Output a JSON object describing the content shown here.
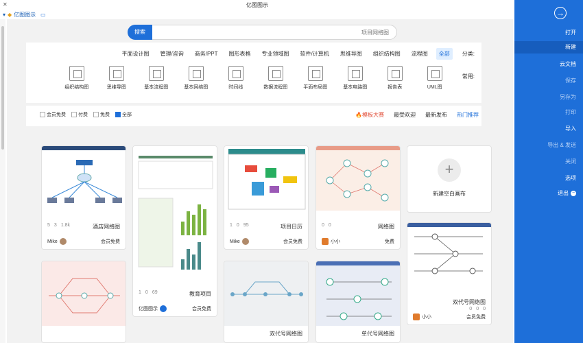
{
  "window": {
    "title": "亿图图示",
    "app_badge": "亿图图示"
  },
  "search": {
    "button": "搜索",
    "placeholder": "项目网络图"
  },
  "categories": {
    "label": "分类:",
    "items": [
      "全部",
      "流程图",
      "组织结构图",
      "思维导图",
      "软件/计算机",
      "专业领域图",
      "图形表格",
      "商务/PPT",
      "管理/咨询",
      "平面设计图"
    ],
    "active": 0
  },
  "common": {
    "label": "常用:",
    "items": [
      {
        "label": "UML图",
        "icon": "uml-icon"
      },
      {
        "label": "报告表",
        "icon": "report-icon"
      },
      {
        "label": "基本电路图",
        "icon": "circuit-icon"
      },
      {
        "label": "平面布局图",
        "icon": "floor-plan-icon"
      },
      {
        "label": "数据流程图",
        "icon": "dataflow-icon"
      },
      {
        "label": "时间线",
        "icon": "timeline-icon"
      },
      {
        "label": "基本网络图",
        "icon": "network-icon"
      },
      {
        "label": "基本流程图",
        "icon": "flowchart-icon"
      },
      {
        "label": "思维导图",
        "icon": "mindmap-icon"
      },
      {
        "label": "组织结构图",
        "icon": "org-icon"
      }
    ]
  },
  "filter": {
    "tabs": [
      {
        "label": "热门推荐",
        "active": true
      },
      {
        "label": "最新发布"
      },
      {
        "label": "最受欢迎"
      },
      {
        "label": "模板大赛",
        "fire": true
      }
    ],
    "checks": [
      {
        "label": "全部",
        "checked": true
      },
      {
        "label": "免费"
      },
      {
        "label": "付费"
      },
      {
        "label": "会员免费"
      }
    ]
  },
  "cards": {
    "new": {
      "label": "新建空白画布"
    },
    "c1": {
      "name": "网络图",
      "views": "0",
      "likes": "0",
      "author": "小小",
      "price": "免费"
    },
    "c2": {
      "name": "项目日历",
      "views": "95",
      "likes": "0",
      "saves": "1",
      "author": "Mike",
      "price": "会员免费"
    },
    "c3": {
      "name": "教育项目",
      "views": "69",
      "likes": "0",
      "saves": "1",
      "author": "亿图图示",
      "price": "会员免费"
    },
    "c4": {
      "name": "酒店网络图",
      "views": "1.8k",
      "likes": "3",
      "saves": "5",
      "author": "Mike",
      "price": "会员免费"
    },
    "c5": {
      "name": "双代号网络图",
      "views": "0",
      "likes": "0",
      "saves": "0",
      "author": "小小",
      "price": "会员免费"
    },
    "c6": {
      "name": "单代号网络图"
    },
    "c7": {
      "name": "双代号网络图"
    }
  },
  "sidebar": {
    "items": [
      {
        "label": "打开"
      },
      {
        "label": "新建",
        "active": true
      },
      {
        "label": "云文档"
      },
      {
        "label": "保存",
        "dim": true
      },
      {
        "label": "另存为",
        "dim": true
      },
      {
        "label": "打印",
        "dim": true
      },
      {
        "label": "导入"
      },
      {
        "label": "导出 & 发送",
        "dim": true
      },
      {
        "label": "关闭",
        "dim": true
      },
      {
        "label": "选项"
      },
      {
        "label": "退出"
      }
    ]
  }
}
